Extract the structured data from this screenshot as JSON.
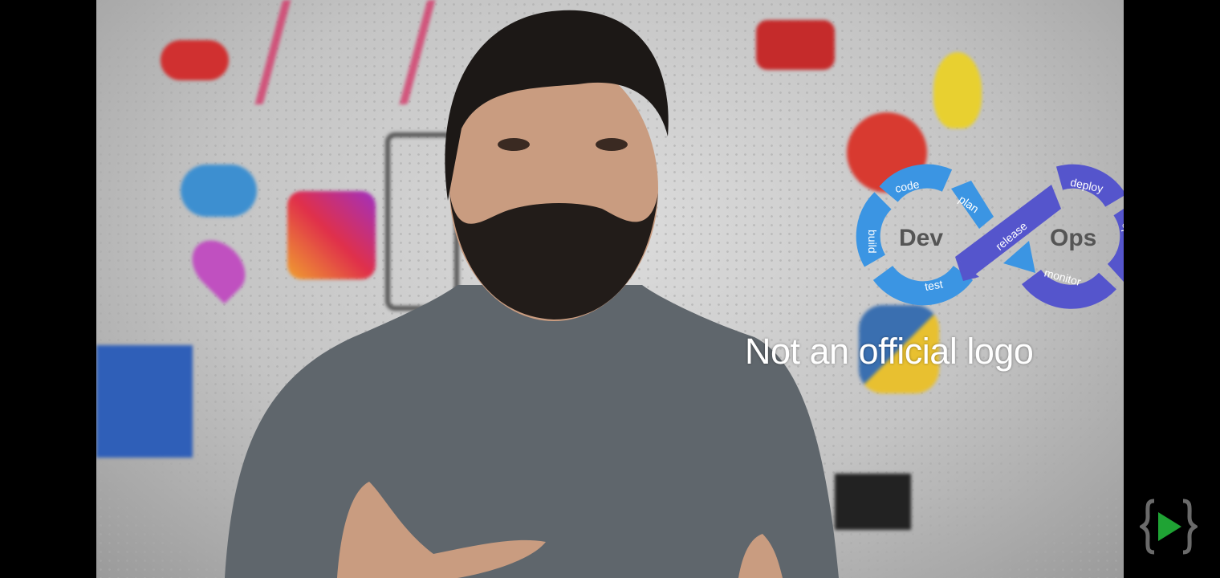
{
  "video": {
    "caption": "Not an official logo",
    "logo": {
      "dev_label": "Dev",
      "ops_label": "Ops",
      "dev_stages": [
        "code",
        "plan",
        "build",
        "test"
      ],
      "release_label": "release",
      "ops_stages": [
        "deploy",
        "operate",
        "monitor"
      ],
      "colors": {
        "dev": "#3b95e3",
        "ops": "#5555cc",
        "center_text": "#555555"
      }
    }
  },
  "brand_icon": {
    "name": "curly-braces-play-icon",
    "colors": {
      "braces": "#6a6a6a",
      "play": "#1fa334"
    }
  }
}
